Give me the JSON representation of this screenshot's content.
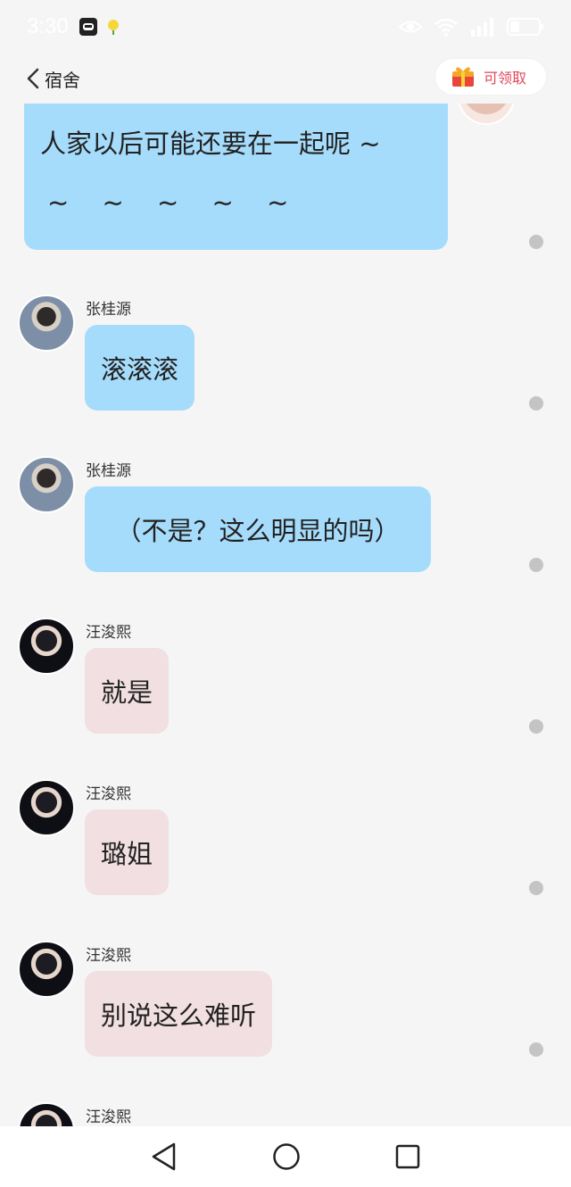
{
  "status_bar": {
    "time": "3:30"
  },
  "header": {
    "title": "宿舍",
    "reward_label": "可领取"
  },
  "top_message": {
    "line1": "人家以后可能还要在一起呢 ~",
    "line2": "~ ~ ~ ~ ~"
  },
  "messages": [
    {
      "sender": "张桂源",
      "text": "滚滚滚",
      "style": "blue"
    },
    {
      "sender": "张桂源",
      "text": "（不是？这么明显的吗）",
      "style": "blue"
    },
    {
      "sender": "汪浚熙",
      "text": "就是",
      "style": "pink"
    },
    {
      "sender": "汪浚熙",
      "text": "璐姐",
      "style": "pink"
    },
    {
      "sender": "汪浚熙",
      "text": "别说这么难听",
      "style": "pink"
    },
    {
      "sender": "汪浚熙",
      "text": "",
      "style": "pink"
    }
  ],
  "colors": {
    "bubble_blue": "#a6dcfb",
    "bubble_pink": "#f1dfe1",
    "background": "#f5f5f5",
    "reward_text": "#e0485a"
  }
}
